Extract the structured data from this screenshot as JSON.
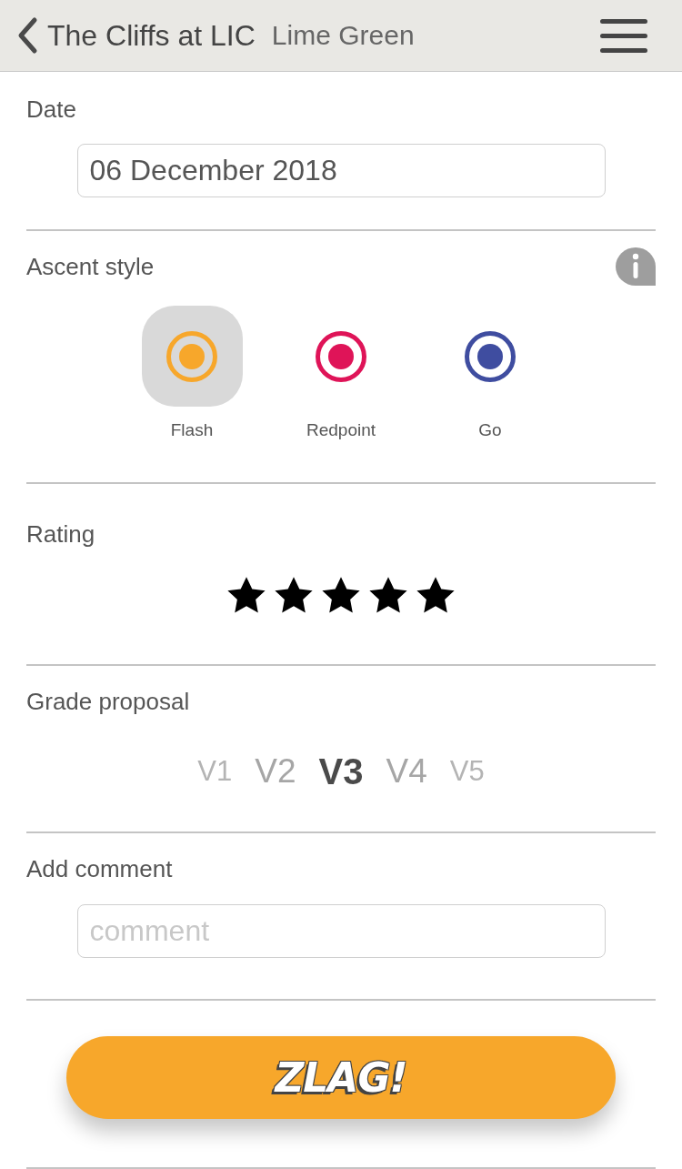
{
  "header": {
    "title": "The Cliffs at LIC",
    "subtitle": "Lime Green"
  },
  "date": {
    "label": "Date",
    "value": "06 December 2018"
  },
  "ascent_style": {
    "label": "Ascent style",
    "options": [
      {
        "label": "Flash",
        "selected": true,
        "color": "#f7a72b"
      },
      {
        "label": "Redpoint",
        "selected": false,
        "color": "#df1458"
      },
      {
        "label": "Go",
        "selected": false,
        "color": "#3f4da0"
      }
    ]
  },
  "rating": {
    "label": "Rating",
    "stars": 5
  },
  "grade_proposal": {
    "label": "Grade proposal",
    "grades": [
      {
        "label": "V1",
        "selected": false
      },
      {
        "label": "V2",
        "selected": false
      },
      {
        "label": "V3",
        "selected": true
      },
      {
        "label": "V4",
        "selected": false
      },
      {
        "label": "V5",
        "selected": false
      }
    ]
  },
  "comment": {
    "label": "Add comment",
    "placeholder": "comment"
  },
  "submit_button": {
    "label": "ZLAG!"
  }
}
